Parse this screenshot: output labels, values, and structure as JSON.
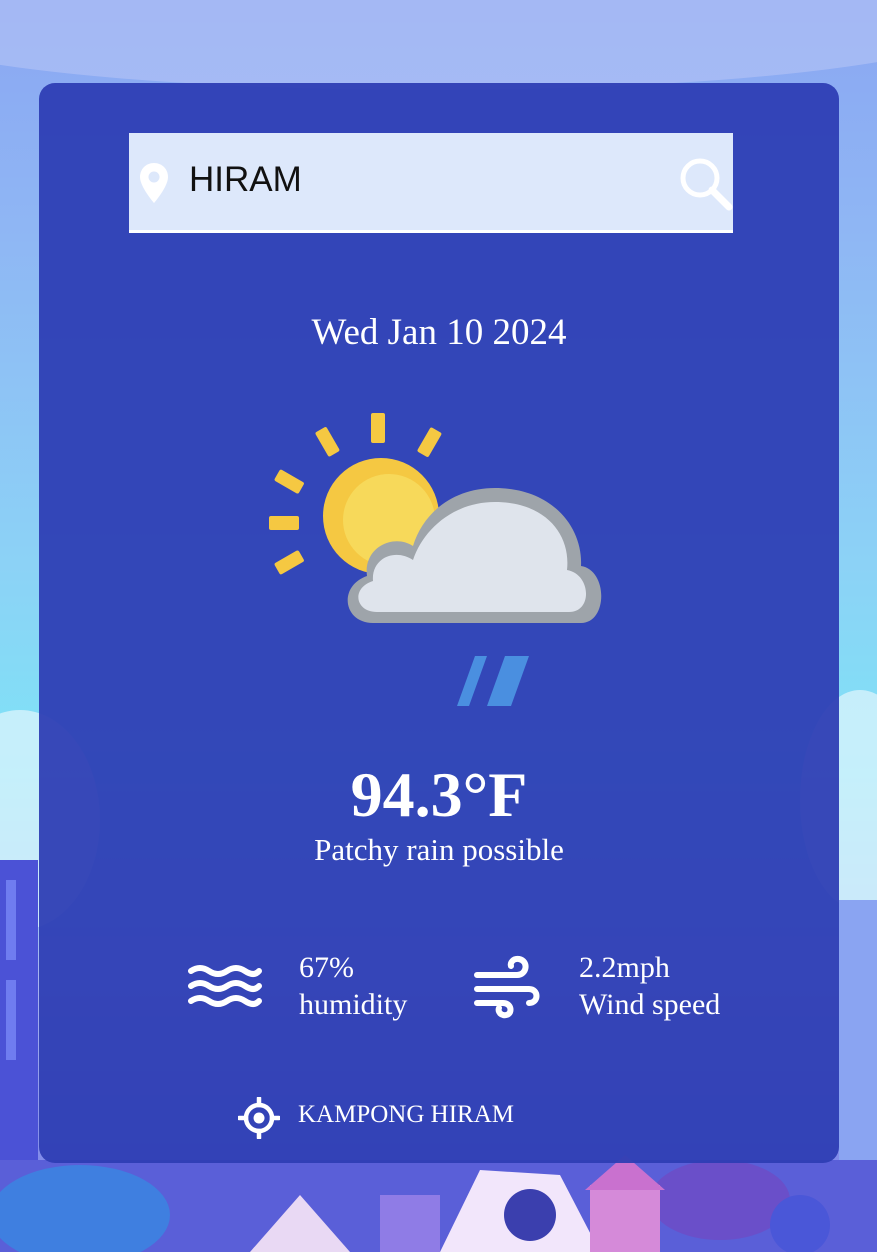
{
  "search": {
    "value": "HIRAM",
    "pin_icon": "map-pin-icon",
    "search_icon": "magnifier-icon"
  },
  "weather": {
    "date": "Wed Jan 10 2024",
    "icon": "partly-cloudy-rain-icon",
    "temperature": "94.3°F",
    "condition": "Patchy rain possible"
  },
  "details": {
    "humidity": {
      "icon": "humidity-waves-icon",
      "value": "67%",
      "label": "humidity"
    },
    "wind": {
      "icon": "wind-icon",
      "value": "2.2mph",
      "label": "Wind speed"
    }
  },
  "location": {
    "icon": "crosshair-location-icon",
    "name": "KAMPONG HIRAM"
  },
  "colors": {
    "card": "#2e3eb4",
    "search_bg": "#dde8fb",
    "text": "#ffffff",
    "sun": "#f5c842",
    "cloud": "#dfe4ec",
    "rain": "#4a8fe0"
  }
}
